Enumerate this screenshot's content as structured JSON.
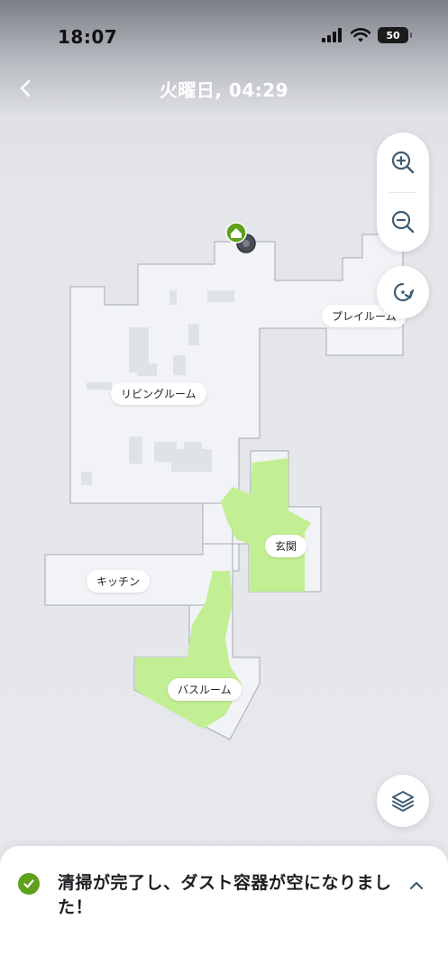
{
  "status_bar": {
    "time": "18:07",
    "battery": "50"
  },
  "header": {
    "title": "火曜日, 04:29"
  },
  "map": {
    "rooms": [
      {
        "id": "living",
        "label": "リビングルーム"
      },
      {
        "id": "play",
        "label": "プレイルーム"
      },
      {
        "id": "entrance",
        "label": "玄関"
      },
      {
        "id": "kitchen",
        "label": "キッチン"
      },
      {
        "id": "bath",
        "label": "バスルーム"
      }
    ],
    "colors": {
      "floor": "#f1f3f6",
      "outline": "#a6abb3",
      "cleaned": "#c2ef94",
      "dock": "#5fa11a"
    }
  },
  "controls": {
    "zoom_in_icon": "zoom-in-icon",
    "zoom_out_icon": "zoom-out-icon",
    "rotate_icon": "rotate-icon",
    "layers_icon": "layers-icon"
  },
  "notification": {
    "message": "清掃が完了し、ダスト容器が空になりました！",
    "status_color": "#5fa11a"
  }
}
